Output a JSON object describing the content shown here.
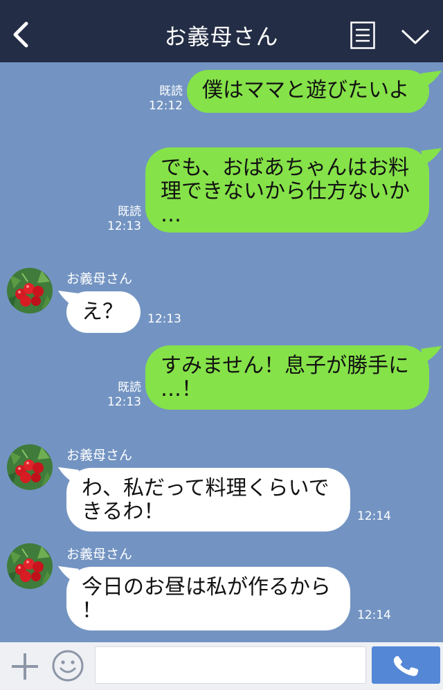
{
  "header": {
    "title": "お義母さん",
    "back_icon": "chevron-left-icon",
    "menu_icon": "note-menu-icon",
    "expand_icon": "chevron-down-icon"
  },
  "messages": [
    {
      "direction": "out",
      "text": "僕はママと遊びたいよ",
      "read": "既読",
      "time": "12:12"
    },
    {
      "direction": "out",
      "text": "でも、おばあちゃんはお料\n理できないから仕方ないか\n…",
      "read": "既読",
      "time": "12:13"
    },
    {
      "direction": "in",
      "sender": "お義母さん",
      "text": "え？",
      "time": "12:13"
    },
    {
      "direction": "out",
      "text": "すみません！息子が勝手に\n…！",
      "read": "既読",
      "time": "12:13"
    },
    {
      "direction": "in",
      "sender": "お義母さん",
      "text": "わ、私だって料理くらいで\nきるわ！",
      "time": "12:14"
    },
    {
      "direction": "in",
      "sender": "お義母さん",
      "text": "今日のお昼は私が作るから\n！",
      "time": "12:14"
    }
  ],
  "input": {
    "value": "",
    "placeholder": ""
  },
  "icons": {
    "plus": "plus-icon",
    "emoji": "smile-icon",
    "call": "phone-icon",
    "avatar": "cherry-avatar"
  },
  "colors": {
    "header_bg": "#232d45",
    "chat_bg": "#7394c2",
    "outgoing_bubble": "#85e249",
    "incoming_bubble": "#ffffff",
    "call_button": "#5488d6"
  }
}
